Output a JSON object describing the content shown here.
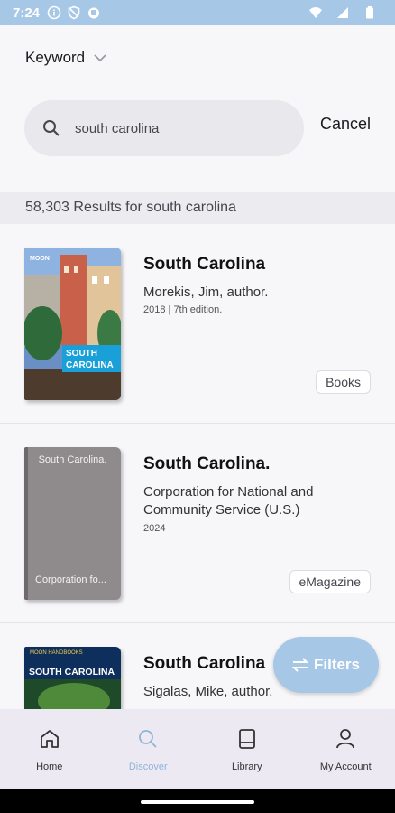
{
  "status_bar": {
    "time": "7:24"
  },
  "header": {
    "keyword_label": "Keyword",
    "search_value": "south carolina",
    "cancel_label": "Cancel"
  },
  "results": {
    "summary": "58,303 Results for south carolina",
    "items": [
      {
        "title": "South Carolina",
        "author": "Morekis, Jim, author.",
        "meta": "2018 | 7th edition.",
        "type": "Books",
        "cover_text": {
          "brand": "MOON",
          "line1": "SOUTH",
          "line2": "CAROLINA"
        }
      },
      {
        "title": "South Carolina.",
        "author": "Corporation for National and Community Service (U.S.)",
        "meta": "2024",
        "type": "eMagazine",
        "cover_text": {
          "top": "South Carolina.",
          "bottom": "Corporation fo..."
        }
      },
      {
        "title": "South Carolina",
        "author": "Sigalas, Mike, author.",
        "meta": "",
        "cover_text": {
          "line1": "MOON HANDBOOKS",
          "line2": "SOUTH CAROLINA"
        }
      }
    ]
  },
  "fab": {
    "label": "Filters"
  },
  "nav": {
    "home": "Home",
    "discover": "Discover",
    "library": "Library",
    "account": "My Account"
  },
  "colors": {
    "accent": "#a7c7e7",
    "nav_active": "#8fb4da",
    "nav_background": "#ece9f2"
  }
}
